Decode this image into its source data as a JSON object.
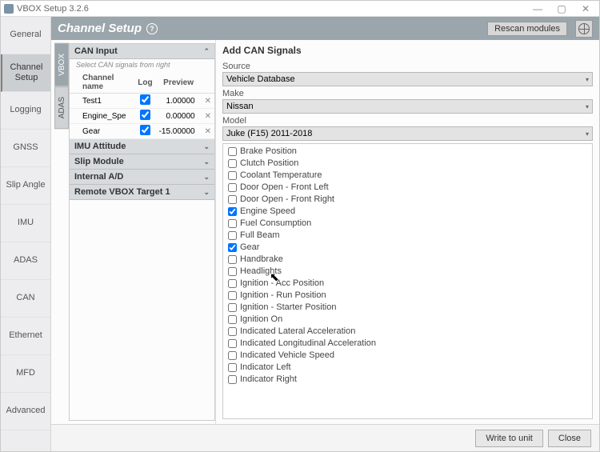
{
  "window": {
    "title": "VBOX Setup 3.2.6"
  },
  "header": {
    "title": "Channel Setup",
    "rescan": "Rescan modules"
  },
  "sidenav": {
    "items": [
      {
        "label": "General"
      },
      {
        "label": "Channel Setup"
      },
      {
        "label": "Logging"
      },
      {
        "label": "GNSS"
      },
      {
        "label": "Slip Angle"
      },
      {
        "label": "IMU"
      },
      {
        "label": "ADAS"
      },
      {
        "label": "CAN"
      },
      {
        "label": "Ethernet"
      },
      {
        "label": "MFD"
      },
      {
        "label": "Advanced"
      }
    ],
    "active_index": 1
  },
  "vtabs": {
    "items": [
      "VBOX",
      "ADAS"
    ],
    "active_index": 0
  },
  "accordions": {
    "can_input": {
      "title": "CAN Input",
      "hint": "Select CAN signals from right",
      "cols": [
        "Channel name",
        "Log",
        "Preview"
      ],
      "rows": [
        {
          "name": "Test1",
          "log": true,
          "preview": "1.00000"
        },
        {
          "name": "Engine_Spe",
          "log": true,
          "preview": "0.00000"
        },
        {
          "name": "Gear",
          "log": true,
          "preview": "-15.00000"
        }
      ]
    },
    "others": [
      "IMU Attitude",
      "Slip Module",
      "Internal A/D",
      "Remote VBOX Target 1"
    ]
  },
  "right": {
    "title": "Add CAN Signals",
    "source_label": "Source",
    "source_value": "Vehicle Database",
    "make_label": "Make",
    "make_value": "Nissan",
    "model_label": "Model",
    "model_value": "Juke (F15) 2011-2018",
    "signals": [
      {
        "label": "Brake Position",
        "checked": false
      },
      {
        "label": "Clutch Position",
        "checked": false
      },
      {
        "label": "Coolant Temperature",
        "checked": false
      },
      {
        "label": "Door Open - Front Left",
        "checked": false
      },
      {
        "label": "Door Open - Front Right",
        "checked": false
      },
      {
        "label": "Engine Speed",
        "checked": true
      },
      {
        "label": "Fuel Consumption",
        "checked": false
      },
      {
        "label": "Full Beam",
        "checked": false
      },
      {
        "label": "Gear",
        "checked": true
      },
      {
        "label": "Handbrake",
        "checked": false
      },
      {
        "label": "Headlights",
        "checked": false
      },
      {
        "label": "Ignition - Acc Position",
        "checked": false
      },
      {
        "label": "Ignition - Run Position",
        "checked": false
      },
      {
        "label": "Ignition - Starter Position",
        "checked": false
      },
      {
        "label": "Ignition On",
        "checked": false
      },
      {
        "label": "Indicated Lateral Acceleration",
        "checked": false
      },
      {
        "label": "Indicated Longitudinal Acceleration",
        "checked": false
      },
      {
        "label": "Indicated Vehicle Speed",
        "checked": false
      },
      {
        "label": "Indicator Left",
        "checked": false
      },
      {
        "label": "Indicator Right",
        "checked": false
      }
    ]
  },
  "footer": {
    "write": "Write to unit",
    "close": "Close"
  }
}
